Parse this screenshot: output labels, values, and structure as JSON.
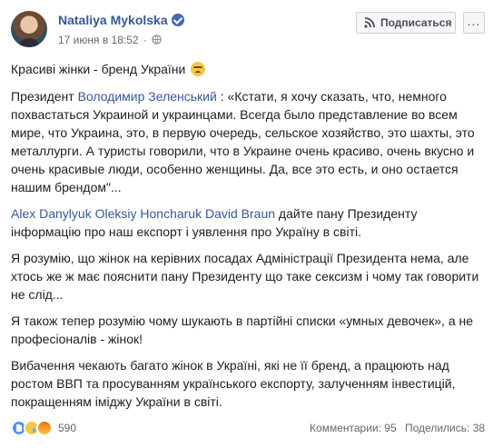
{
  "post": {
    "author": "Nataliya Mykolska",
    "date": "17 июня в 18:52",
    "meta_dot": "·",
    "subscribe_label": "Подписаться",
    "more_label": "...",
    "icons": {
      "verified": "verified-badge",
      "privacy": "globe-icon",
      "subscribe": "rss-icon",
      "more": "ellipsis-icon"
    }
  },
  "body": {
    "line1": "Красиві жінки - бренд України",
    "p2_link": "Володимир Зеленський",
    "p2_prefix": "Президент ",
    "p2_text": " : «Кстати, я хочу сказать, что, немного похвастаться Украиной и украинцами. Всегда было представление во всем мире, что Украина, это, в первую очередь, сельское хозяйство, это шахты, это металлурги. А туристы говорили, что в Украине очень красиво, очень вкусно и очень красивые люди, особенно женщины. Да, все это есть, и оно остается нашим брендом\"...",
    "p3_links": [
      "Alex Danylyuk",
      "Oleksiy Honcharuk",
      "David Braun"
    ],
    "p3_text": " дайте пану Президенту інформацію про наш експорт і уявлення про Україну в світі.",
    "p4": "Я розумію, що жінок на керівних посадах Адміністрації Президента нема, але хтось же ж має пояснити пану Президенту що таке сексизм і чому так говорити не слід...",
    "p5": "Я також тепер розумію чому шукають в партійні списки «умных девочек», а не професіоналів - жінок!",
    "p6": "Вибачення чекають багато жінок в Україні, які не її бренд, а працюють над ростом ВВП та просуванням українського експорту, залученням інвестицій, покращенням іміджу України в світі."
  },
  "footer": {
    "reaction_icons": [
      "like-icon",
      "sad-icon",
      "angry-icon"
    ],
    "reaction_count": "590",
    "comments": "Комментарии: 95",
    "shares": "Поделились: 38"
  },
  "colors": {
    "link": "#385898",
    "text": "#1c1e21",
    "meta": "#616770"
  }
}
